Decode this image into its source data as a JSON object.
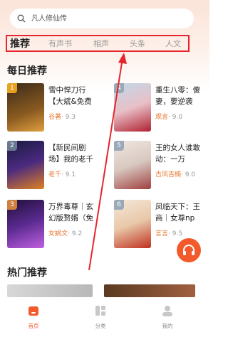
{
  "search": {
    "placeholder": "凡人修仙传"
  },
  "tabs": [
    {
      "label": "推荐",
      "active": true
    },
    {
      "label": "有声书"
    },
    {
      "label": "相声"
    },
    {
      "label": "头条"
    },
    {
      "label": "人文"
    }
  ],
  "daily": {
    "title": "每日推荐",
    "books": [
      {
        "rank": "1",
        "title1": "雪中悍刀行",
        "title2": "【大斌&免费",
        "author": "",
        "score": "· 9.3"
      },
      {
        "rank": "4",
        "title1": "重生八零：傻",
        "title2": "妻，要逆袭",
        "author": "观言",
        "score": "· 9.0"
      },
      {
        "rank": "2",
        "title1": "【新民间剧",
        "title2": "场】我的老千",
        "author": "老千",
        "score": "· 9.1"
      },
      {
        "rank": "5",
        "title1": "王的女人谁敢",
        "title2": "动：一万",
        "author": "古风吉楠",
        "score": "· 9.0"
      },
      {
        "rank": "3",
        "title1": "万界毒尊｜玄",
        "title2": "幻版赘婿（免",
        "author": "女娲文",
        "score": "· 9.2"
      },
      {
        "rank": "6",
        "title1": "凤临天下：王",
        "title2": "商｜女尊np",
        "author": "言言",
        "score": "· 9.5"
      }
    ],
    "author1": "谷著"
  },
  "hot": {
    "title": "热门推荐"
  },
  "nav": [
    {
      "label": "首页",
      "active": true
    },
    {
      "label": "分类"
    },
    {
      "label": "我的"
    }
  ],
  "colors": {
    "accent": "#f25a2b",
    "highlight": "#e8242d"
  },
  "icons": [
    "search-icon",
    "headphones-icon",
    "home-icon",
    "category-icon",
    "profile-icon"
  ]
}
